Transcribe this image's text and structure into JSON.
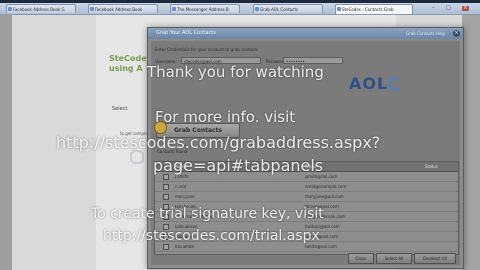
{
  "browser": {
    "tabs": [
      {
        "label": "Facebook Address Book G"
      },
      {
        "label": "Facebook Address Book"
      },
      {
        "label": "The Messenger Address B"
      },
      {
        "label": "Grab AOL Contacts"
      },
      {
        "label": "SteCodes - Contacts Grab",
        "active": true
      }
    ],
    "minimize": "–",
    "maximize": "□",
    "close": "×"
  },
  "page": {
    "brand": "SteCodes using A",
    "side_label": "Select",
    "side_label2": "to get sample"
  },
  "dialog": {
    "title": "Grab Your AOL Contacts",
    "title_link": "Grab Contacts Help",
    "close": "×",
    "instructions": "Enter Credentials for your account to grab contacts",
    "email_label": "Username:",
    "email_value": "stecodes@aol.com",
    "password_label": "Password:",
    "password_value": "••••••••",
    "provider": "AOL",
    "grab_button": "Grab Contacts",
    "found_text": "Contacts found",
    "columns": {
      "name": "Name",
      "email": "Email",
      "status": "Status"
    },
    "contacts": [
      {
        "name": "j.smith",
        "email": "jsmith@aol.com"
      },
      {
        "name": "n.reid",
        "email": "nreid@example.com"
      },
      {
        "name": "mary.jane",
        "email": "maryjane@aol.com"
      },
      {
        "name": "tom.brown",
        "email": "tbrown@aol.com"
      },
      {
        "name": "anderson.company",
        "email": "info@anderson.com"
      },
      {
        "name": "kate.wilson",
        "email": "kwilson@aol.com"
      },
      {
        "name": "bob.jones",
        "email": "bjones@aol.com"
      },
      {
        "name": "lisa.white",
        "email": "lwhite@aol.com"
      }
    ],
    "buttons": {
      "close": "Close",
      "select_all": "Select All",
      "deselect_all": "Deselect All"
    }
  },
  "overlay": {
    "line1": "Thank you for watching",
    "line2": "For more info. visit",
    "line3": "http://stescodes.com/grabaddress.aspx?",
    "line4": "page=api#tabpanels",
    "line5": "To create trial signature key, visit",
    "line6": "http://stescodes.com/trial.aspx"
  }
}
